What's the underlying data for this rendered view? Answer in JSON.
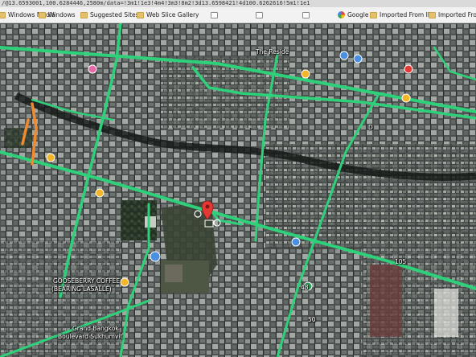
{
  "address_bar": {
    "url_fragment": "/@13.6593001,100.6284446,2580m/data=!3m1!1e3!4m4!3m3!8m2!3d13.6598421!4d100.6262616!5m1!1e1"
  },
  "favorites_bar": [
    {
      "label": "Windows Media",
      "icon": "folder-icon"
    },
    {
      "label": "Windows",
      "icon": "folder-icon"
    },
    {
      "label": "Suggested Sites",
      "icon": "folder-icon"
    },
    {
      "label": "Web Slice Gallery",
      "icon": "folder-icon"
    },
    {
      "label": "",
      "icon": "page-icon"
    },
    {
      "label": "",
      "icon": "page-icon"
    },
    {
      "label": "",
      "icon": "page-icon"
    },
    {
      "label": "Google",
      "icon": "google-icon"
    },
    {
      "label": "Imported From IE",
      "icon": "folder-icon"
    },
    {
      "label": "Imported From IE",
      "icon": "folder-icon"
    }
  ],
  "map": {
    "place_labels": [
      {
        "text": "GOOSEBERRY COFFEE"
      },
      {
        "text": "(BEARING LASALLE)"
      },
      {
        "text": "Grand Bangkok"
      },
      {
        "text": "Boulevard Sukhumvit"
      },
      {
        "text": "The Reside"
      },
      {
        "text": "105"
      },
      {
        "text": "48"
      },
      {
        "text": "D"
      },
      {
        "text": "50"
      }
    ],
    "colors": {
      "road_traffic_green": "#2fd07a",
      "road_traffic_orange": "#f08a2c",
      "selected_pin_red": "#e53935",
      "poi_pin_yellow": "#f5b529",
      "poi_pin_blue": "#4a90e2",
      "poi_pin_green": "#2e9e5b"
    }
  }
}
